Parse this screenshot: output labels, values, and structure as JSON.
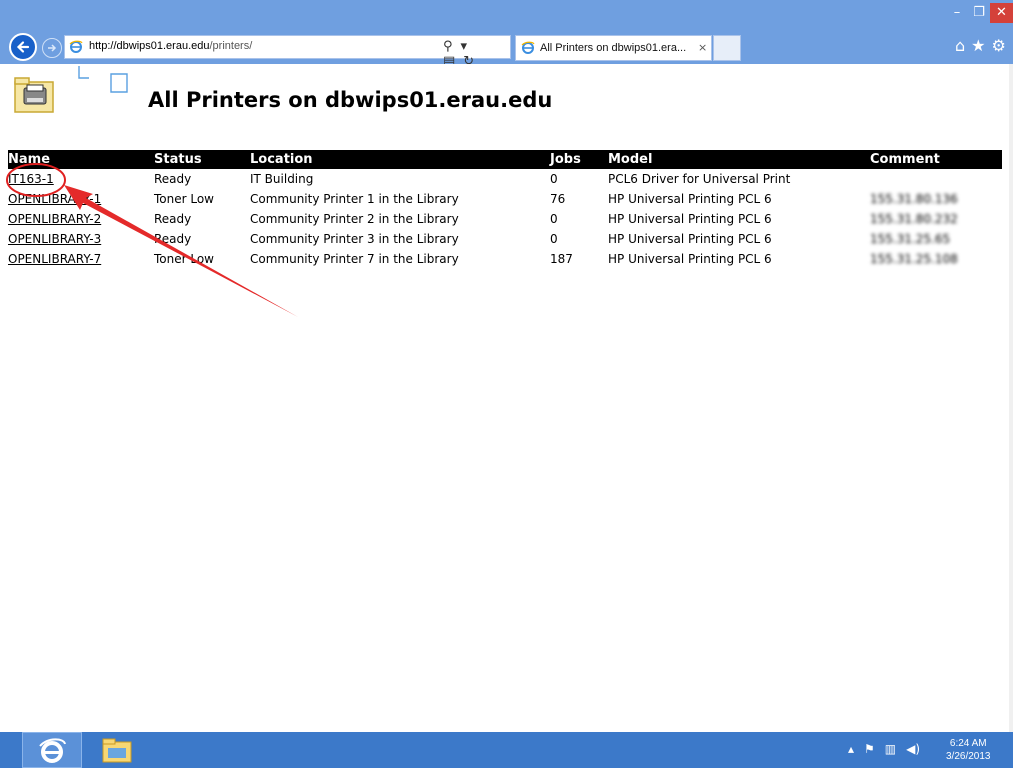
{
  "browser": {
    "url_domain": "http://dbwips01.erau.edu",
    "url_path": "/printers/",
    "tab_title": "All Printers on dbwips01.era...",
    "tab_close": "×",
    "window_controls": {
      "minimize": "–",
      "maximize": "❐",
      "close": "✕"
    },
    "right_icons": {
      "home": "⌂",
      "favorites": "★",
      "settings": "⚙"
    }
  },
  "page": {
    "title": "All Printers on dbwips01.erau.edu"
  },
  "table": {
    "headers": [
      "Name",
      "Status",
      "Location",
      "Jobs",
      "Model",
      "Comment"
    ],
    "rows": [
      {
        "name": "IT163-1",
        "status": "Ready",
        "location": "IT Building",
        "jobs": "0",
        "model": "PCL6 Driver for Universal Print",
        "comment": ""
      },
      {
        "name": "OPENLIBRARY-1",
        "status": "Toner Low",
        "location": "Community Printer 1 in the Library",
        "jobs": "76",
        "model": "HP Universal Printing PCL 6",
        "comment": "155.31.80.136"
      },
      {
        "name": "OPENLIBRARY-2",
        "status": "Ready",
        "location": "Community Printer 2 in the Library",
        "jobs": "0",
        "model": "HP Universal Printing PCL 6",
        "comment": "155.31.80.232"
      },
      {
        "name": "OPENLIBRARY-3",
        "status": "Ready",
        "location": "Community Printer 3 in the Library",
        "jobs": "0",
        "model": "HP Universal Printing PCL 6",
        "comment": "155.31.25.65"
      },
      {
        "name": "OPENLIBRARY-7",
        "status": "Toner Low",
        "location": "Community Printer 7 in the Library",
        "jobs": "187",
        "model": "HP Universal Printing PCL 6",
        "comment": "155.31.25.108"
      }
    ]
  },
  "taskbar": {
    "time": "6:24 AM",
    "date": "3/26/2013"
  },
  "colors": {
    "status_ready": "#1a8a1a",
    "status_toner_low": "#e11414",
    "chrome_blue": "#6f9fe0",
    "taskbar_blue": "#3c79c9",
    "annotation_red": "#e02020"
  },
  "icons": [
    "back-arrow-icon",
    "forward-arrow-icon",
    "ie-page-icon",
    "search-icon",
    "compatibility-icon",
    "refresh-icon",
    "home-icon",
    "favorites-star-icon",
    "settings-gear-icon",
    "printer-folder-icon",
    "ie-taskbar-icon",
    "file-explorer-icon",
    "flag-icon",
    "network-icon",
    "volume-icon"
  ]
}
